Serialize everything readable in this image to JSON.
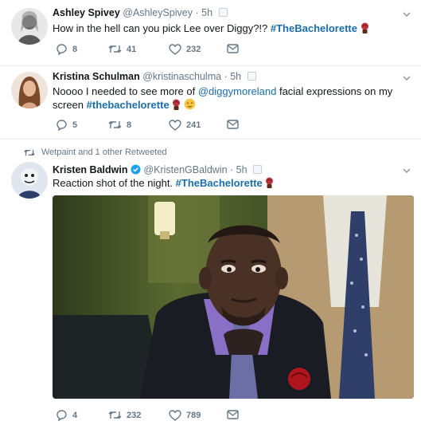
{
  "tweets": [
    {
      "name": "Ashley Spivey",
      "handle": "@AshleySpivey",
      "dot": "·",
      "time": "5h",
      "text_main": "How in the hell can you pick Lee over Diggy?!? ",
      "hashtag": "#TheBachelorette",
      "replies": "8",
      "retweets": "41",
      "likes": "232"
    },
    {
      "name": "Kristina Schulman",
      "handle": "@kristinaschulma",
      "dot": "·",
      "time": "5h",
      "text_pre": "Noooo I needed to see more of ",
      "mention": "@diggymoreland",
      "text_post": " facial expressions on my screen ",
      "hashtag": "#thebachelorette",
      "replies": "5",
      "retweets": "8",
      "likes": "241"
    },
    {
      "retweeted_by": "Wetpaint and 1 other Retweeted",
      "name": "Kristen Baldwin",
      "handle": "@KristenGBaldwin",
      "dot": "·",
      "time": "5h",
      "text_main": "Reaction shot of the night. ",
      "hashtag": "#TheBachelorette",
      "replies": "4",
      "retweets": "232",
      "likes": "789"
    }
  ],
  "icons": {
    "reply": "reply-icon",
    "retweet": "retweet-icon",
    "like": "heart-icon",
    "dm": "envelope-icon",
    "more": "chevron-down-icon",
    "verified": "verified-badge-icon",
    "rose_emoji": "rose-emoji-icon",
    "relieved_emoji": "relieved-face-emoji-icon"
  },
  "colors": {
    "hashtag": "#1b6ea8",
    "secondary_text": "#657786",
    "verified": "#1da1f2"
  }
}
